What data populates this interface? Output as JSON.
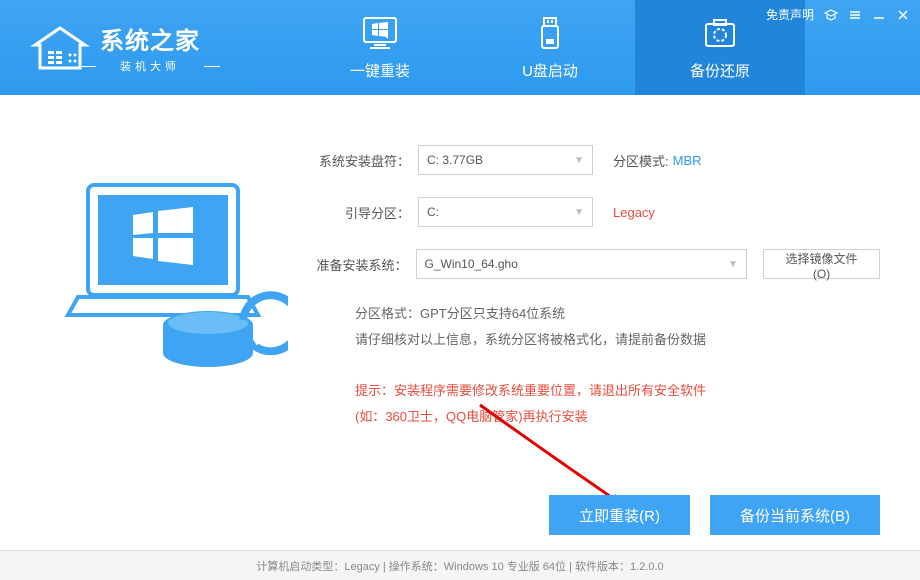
{
  "window_controls": {
    "disclaimer": "免责声明"
  },
  "branding": {
    "title": "系统之家",
    "subtitle": "装机大师"
  },
  "tabs": {
    "reinstall": "一键重装",
    "usb_boot": "U盘启动",
    "backup_restore": "备份还原"
  },
  "form": {
    "install_drive_label": "系统安装盘符：",
    "install_drive_value": "C: 3.77GB",
    "partition_mode_label": "分区模式:",
    "partition_mode_value": "MBR",
    "boot_partition_label": "引导分区：",
    "boot_partition_value": "C:",
    "boot_mode_value": "Legacy",
    "prepare_system_label": "准备安装系统：",
    "prepare_system_value": "G_Win10_64.gho",
    "browse_button": "选择镜像文件(O)"
  },
  "info": {
    "line1": "分区格式：GPT分区只支持64位系统",
    "line2": "请仔细核对以上信息，系统分区将被格式化，请提前备份数据"
  },
  "warning": {
    "line1": "提示：安装程序需要修改系统重要位置，请退出所有安全软件",
    "line2": "(如：360卫士，QQ电脑管家)再执行安装"
  },
  "actions": {
    "reinstall_now": "立即重装(R)",
    "backup_current": "备份当前系统(B)"
  },
  "statusbar": {
    "text": "计算机启动类型：Legacy | 操作系统：Windows 10 专业版 64位 | 软件版本：1.2.0.0"
  }
}
